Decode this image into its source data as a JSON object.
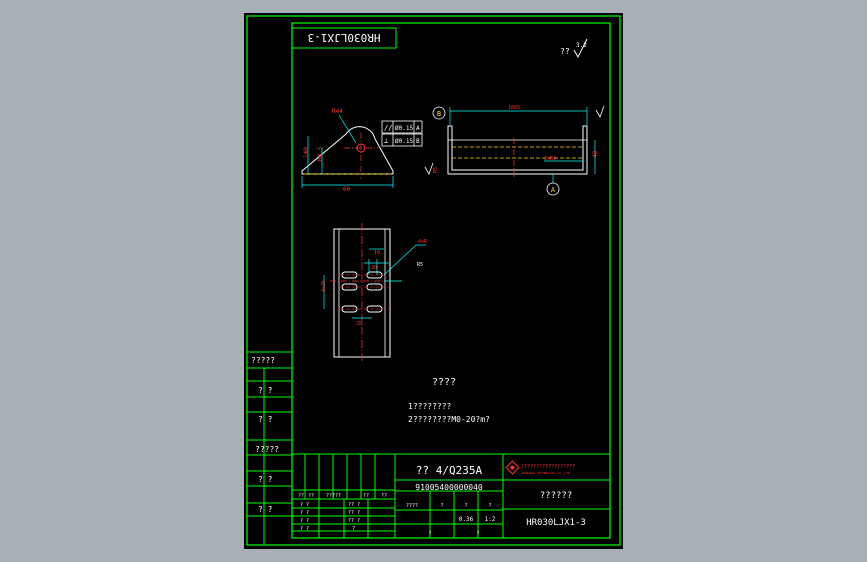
{
  "drawing": {
    "code_box": "HR030LJX1-3",
    "roughness": "??",
    "roughness_value": "3.2",
    "tech_req_title": "????",
    "tech_req_1": "1????????",
    "tech_req_2": "2????????M0-20?m?"
  },
  "left_column_labels": [
    "?????",
    "? ?",
    "? ?",
    "?????",
    "? ?",
    "? ?"
  ],
  "part_view": {
    "label_r": "R44",
    "dim_h": "140",
    "dim_inner_h": "R4.5",
    "dim_w": "60",
    "tol_1_sym": "//",
    "tol_1_val": "Ø0.15",
    "tol_1_ref": "A",
    "tol_2_sym": "⊥",
    "tol_2_val": "Ø0.15",
    "tol_2_ref": "B",
    "datum_b": "B",
    "datum_a": "A",
    "dim_len": "1665",
    "dim_depth": "40",
    "dim_hole": "2xR4",
    "dim_r": "R5",
    "dim_slot_w": "10",
    "dim_slot_pitch": "20",
    "dim_slot_len": "28",
    "dim_vert": "3x25",
    "dim_slot_r": "4xR",
    "dim_slot_r2": "R5"
  },
  "title_block": {
    "material": "?? 4/Q235A",
    "part_number": "91005400000040",
    "company": "??????????????????",
    "company_en": "SHANGHAI TECHNOLOGY CO.,LTD",
    "part_name": "??????",
    "drawing_code": "HR030LJX1-3",
    "row1": [
      "??",
      "??",
      "?????",
      "??",
      "??"
    ],
    "row2": [
      "? ?",
      "?? ?"
    ],
    "row3": [
      "? ?",
      "?? ?"
    ],
    "row4": [
      "? ?",
      "?? ?"
    ],
    "row5": [
      "? ?",
      "?"
    ],
    "mid_labels": [
      "????",
      "?",
      "?",
      "?"
    ],
    "weight": "0.36",
    "scale": "1:2",
    "sheet_a": "?",
    "sheet_b": "?"
  },
  "colors": {
    "background": "#a9afb7",
    "border": "#00ff00",
    "dimension": "#00ffff",
    "annotation": "#ff3333",
    "geometry": "#ffffff",
    "hidden": "#ffd400"
  }
}
